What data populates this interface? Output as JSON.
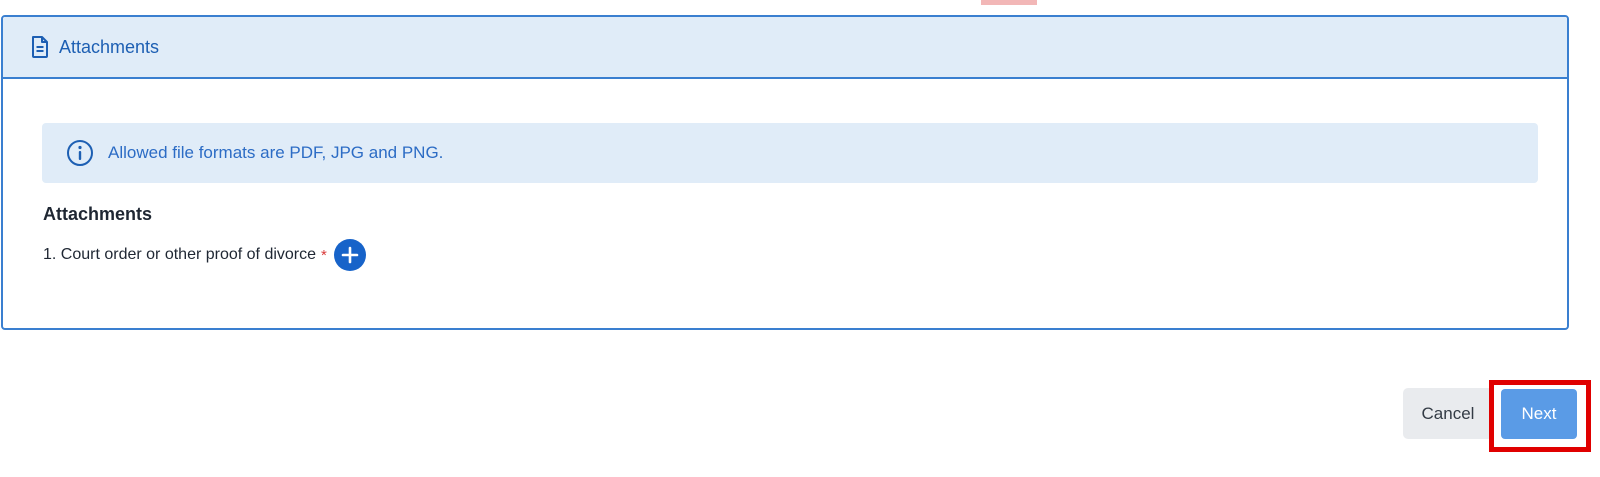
{
  "card": {
    "title": "Attachments",
    "icon": "document-icon"
  },
  "info": {
    "icon": "info-icon",
    "text": "Allowed file formats are PDF, JPG and PNG."
  },
  "attachments": {
    "label": "Attachments",
    "items": [
      {
        "label": "1. Court order or other proof of divorce",
        "required_marker": "*",
        "add_icon": "plus-icon"
      }
    ]
  },
  "actions": {
    "cancel_label": "Cancel",
    "next_label": "Next"
  },
  "colors": {
    "accent": "#1763c9",
    "header_bg": "#e0ecf8",
    "border": "#3a7fd0",
    "highlight": "#e00000",
    "required": "#d93a3a"
  }
}
